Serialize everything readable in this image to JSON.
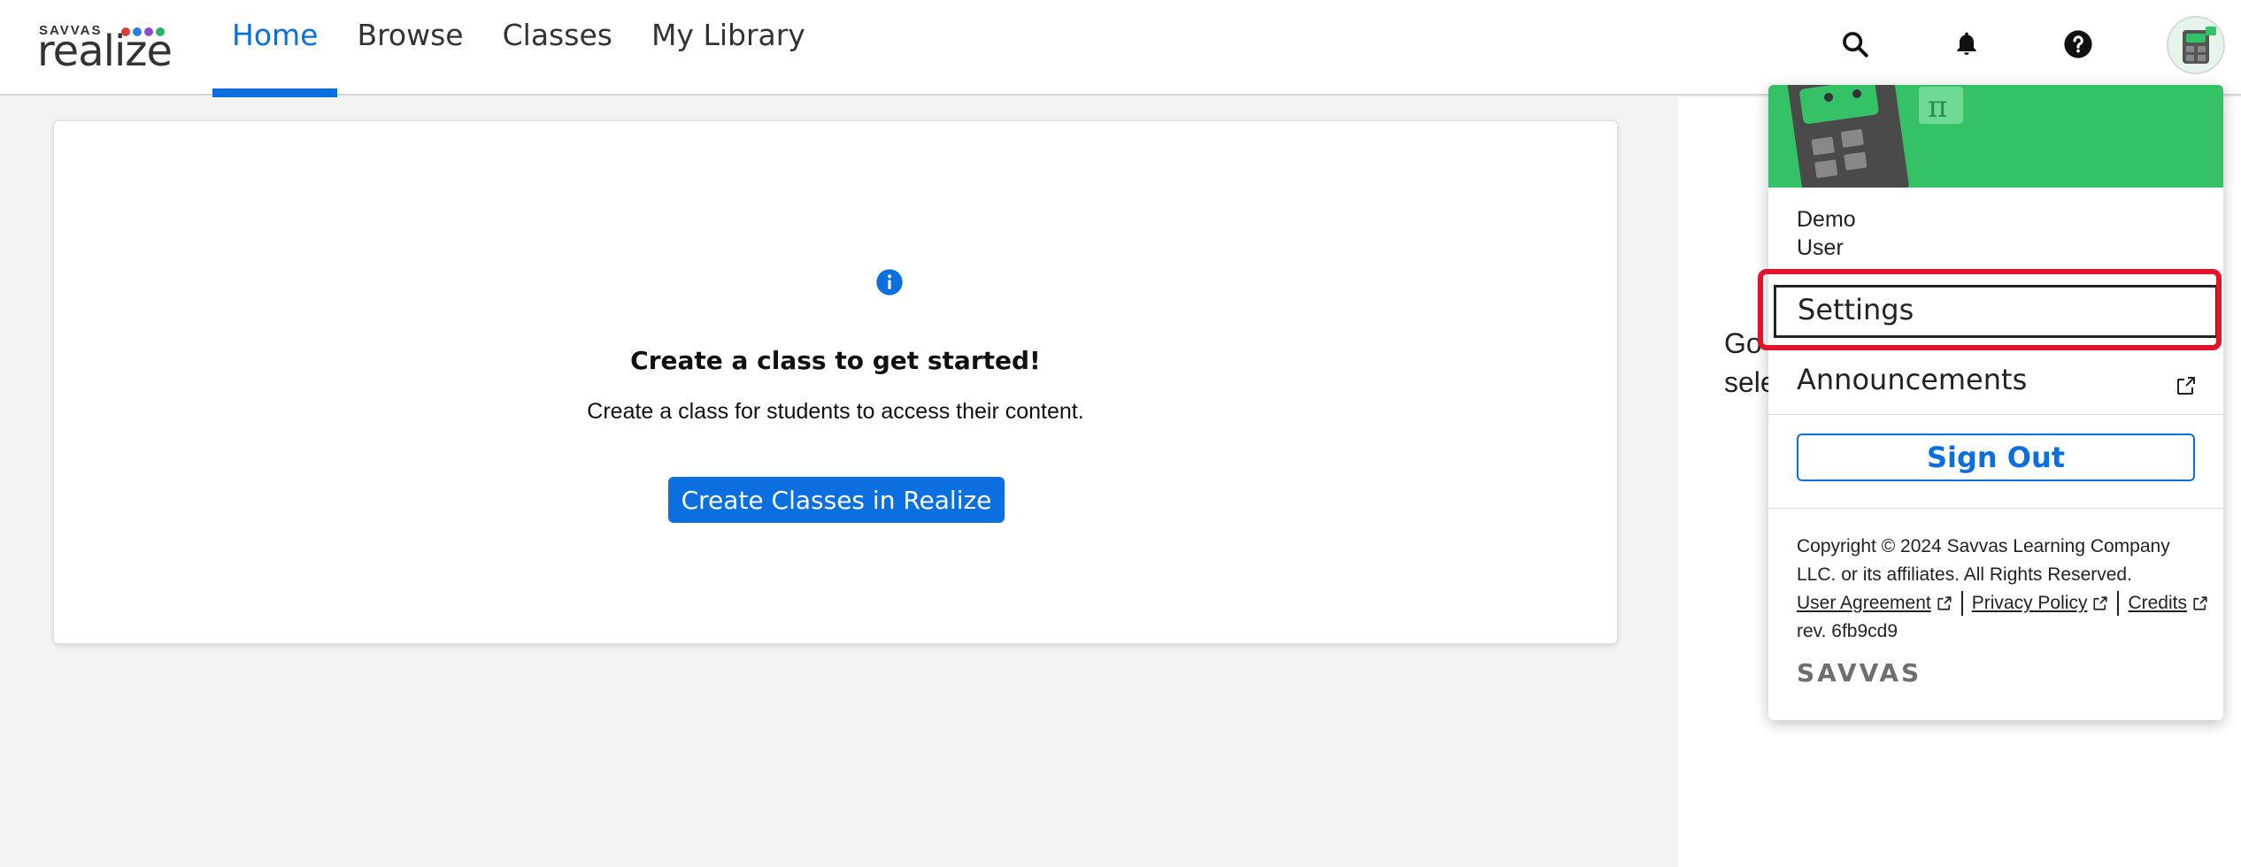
{
  "header": {
    "logo_small": "SAVVAS",
    "logo_main": "realize",
    "logo_dot_colors": [
      "#e03a3a",
      "#2a7de1",
      "#8c4fc9",
      "#2ab36b"
    ],
    "accent_color": "#0b6fe0",
    "nav": [
      {
        "label": "Home",
        "active": true
      },
      {
        "label": "Browse",
        "active": false
      },
      {
        "label": "Classes",
        "active": false
      },
      {
        "label": "My Library",
        "active": false
      }
    ],
    "icons": [
      "search-icon",
      "bell-icon",
      "help-icon",
      "avatar"
    ]
  },
  "main": {
    "icon": "info-icon",
    "title": "Create a class to get started!",
    "description": "Create a class for students to access their content.",
    "button_label": "Create Classes in Realize"
  },
  "right_panel": {
    "line1": "Go",
    "line2": "sele"
  },
  "menu": {
    "banner_color": "#35c267",
    "first_name": "Demo",
    "last_name": "User",
    "settings_label": "Settings",
    "announcements_label": "Announcements",
    "sign_out_label": "Sign Out",
    "copyright": "Copyright © 2024 Savvas Learning Company LLC. or its affiliates. All Rights Reserved.",
    "links": {
      "user_agreement": "User Agreement",
      "privacy_policy": "Privacy Policy",
      "credits": "Credits"
    },
    "revision": "rev. 6fb9cd9",
    "brand": "SAVVAS"
  }
}
